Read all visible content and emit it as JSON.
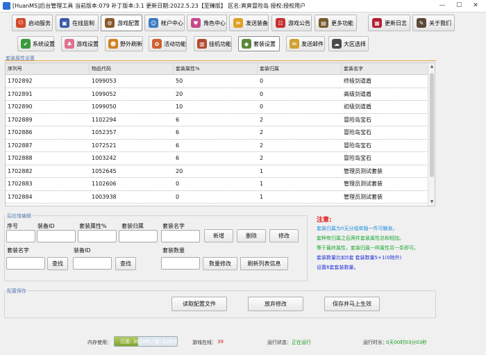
{
  "window": {
    "title": "[HuanMS]后台管理工具 当前版本:079 补丁版本:3.1 更新日期:2022.5.23【至臻版】 区名:爽爽冒险岛 授权:授权用户",
    "minimize": "—",
    "maximize": "☐",
    "close": "✕"
  },
  "main_tabs": [
    {
      "label": "启动服务",
      "icon": "power-icon",
      "color": "#d24a2a"
    },
    {
      "label": "在线监制",
      "icon": "monitor-icon",
      "color": "#3a5aa8"
    },
    {
      "label": "游戏配置",
      "icon": "game-config-icon",
      "color": "#8a5a2a"
    },
    {
      "label": "帐户中心",
      "icon": "account-icon",
      "color": "#3b7bc4"
    },
    {
      "label": "角色中心",
      "icon": "character-icon",
      "color": "#c44b8c"
    },
    {
      "label": "发送装备",
      "icon": "send-equip-icon",
      "color": "#e0a020"
    },
    {
      "label": "游戏公告",
      "icon": "announce-icon",
      "color": "#c83030"
    },
    {
      "label": "更多功能",
      "icon": "more-icon",
      "color": "#7a5a30"
    },
    {
      "label": "更新日志",
      "icon": "log-icon",
      "color": "#b02030"
    },
    {
      "label": "关于我们",
      "icon": "about-icon",
      "color": "#5a4a3a"
    }
  ],
  "sub_tabs": [
    {
      "label": "系统设置",
      "icon": "system-settings-icon",
      "color": "#3a9a3a"
    },
    {
      "label": "游戏设置",
      "icon": "game-settings-icon",
      "color": "#e07090"
    },
    {
      "label": "野外刷新",
      "icon": "field-refresh-icon",
      "color": "#d08020"
    },
    {
      "label": "活动功能",
      "icon": "event-icon",
      "color": "#d06030"
    },
    {
      "label": "挂机功能",
      "icon": "afk-icon",
      "color": "#b04a30"
    },
    {
      "label": "套装设置",
      "icon": "set-settings-icon",
      "color": "#5a8a3a"
    },
    {
      "label": "发送邮件",
      "icon": "mail-icon",
      "color": "#d0a030"
    },
    {
      "label": "大区选择",
      "icon": "region-icon",
      "color": "#4a4a4a"
    }
  ],
  "set_attr": {
    "section_label": "套装属性设置",
    "columns": [
      "序列号",
      "物品代码",
      "套装属性%",
      "套装归属",
      "套装名字"
    ],
    "rows": [
      [
        "1702892",
        "1099053",
        "50",
        "0",
        "终极剑道盾"
      ],
      [
        "1702891",
        "1099052",
        "20",
        "0",
        "高级剑道盾"
      ],
      [
        "1702890",
        "1099050",
        "10",
        "0",
        "初级剑道盾"
      ],
      [
        "1702889",
        "1102294",
        "6",
        "2",
        "冒险岛宝石"
      ],
      [
        "1702886",
        "1052357",
        "6",
        "2",
        "冒险岛宝石"
      ],
      [
        "1702887",
        "1072521",
        "6",
        "2",
        "冒险岛宝石"
      ],
      [
        "1702888",
        "1003242",
        "6",
        "2",
        "冒险岛宝石"
      ],
      [
        "1702882",
        "1052645",
        "20",
        "1",
        "管理员测试套装"
      ],
      [
        "1702883",
        "1102606",
        "0",
        "1",
        "管理员测试套装"
      ],
      [
        "1702884",
        "1003938",
        "0",
        "1",
        "管理员测试套装"
      ]
    ]
  },
  "edit": {
    "section_label": "后应增编辑",
    "seq_label": "序号",
    "equip_id_label": "装备ID",
    "attr_label": "套装属性%",
    "owner_label": "套装归属",
    "name_label": "套装名字",
    "add_button": "新增",
    "delete_button": "删除",
    "modify_button": "修改",
    "search_name_label": "套装名字",
    "search_equip_label": "装备ID",
    "find_button_1": "查找",
    "find_button_2": "查找",
    "count_label": "套装数量",
    "count_modify_button": "数量修改",
    "refresh_button": "刷新列表信息"
  },
  "notes": {
    "title": "注意:",
    "lines": [
      {
        "text": "套装归属为0无分组单独一件可触发。",
        "color": "#1e8de0"
      },
      {
        "text": "套种有归属之后两件套装属性总和相加。",
        "color": "#1aa832"
      },
      {
        "text": "等于最终属性，套装归属一样属性另一条即可。",
        "color": "#1aa832"
      },
      {
        "text": "套装数量比如5套 套装数量5+1(0除外)",
        "color": "#2030d8"
      },
      {
        "text": "设置6套套装数量。",
        "color": "#2030d8"
      }
    ]
  },
  "config": {
    "section_label": "配置保存",
    "read_button": "读取配置文件",
    "discard_button": "放弃修改",
    "save_button": "保存并马上生效"
  },
  "status": {
    "memory_label": "内存使用：",
    "memory_text": "已用: 392MB / 剩: 628MB",
    "memory_fraction": 0.38,
    "online_label": "游戏在线：",
    "online_value": "39",
    "run_state_label": "运行状态：",
    "run_state_value": "正在运行",
    "run_time_label": "运行时长：",
    "run_time_value": "0天00时03分03秒"
  },
  "colors": {
    "accent_orange": "#e0a040",
    "note_red": "#e02020",
    "online_value": "#d02020",
    "running_green": "#1a9a20",
    "memory_green": "#8bb33a"
  }
}
